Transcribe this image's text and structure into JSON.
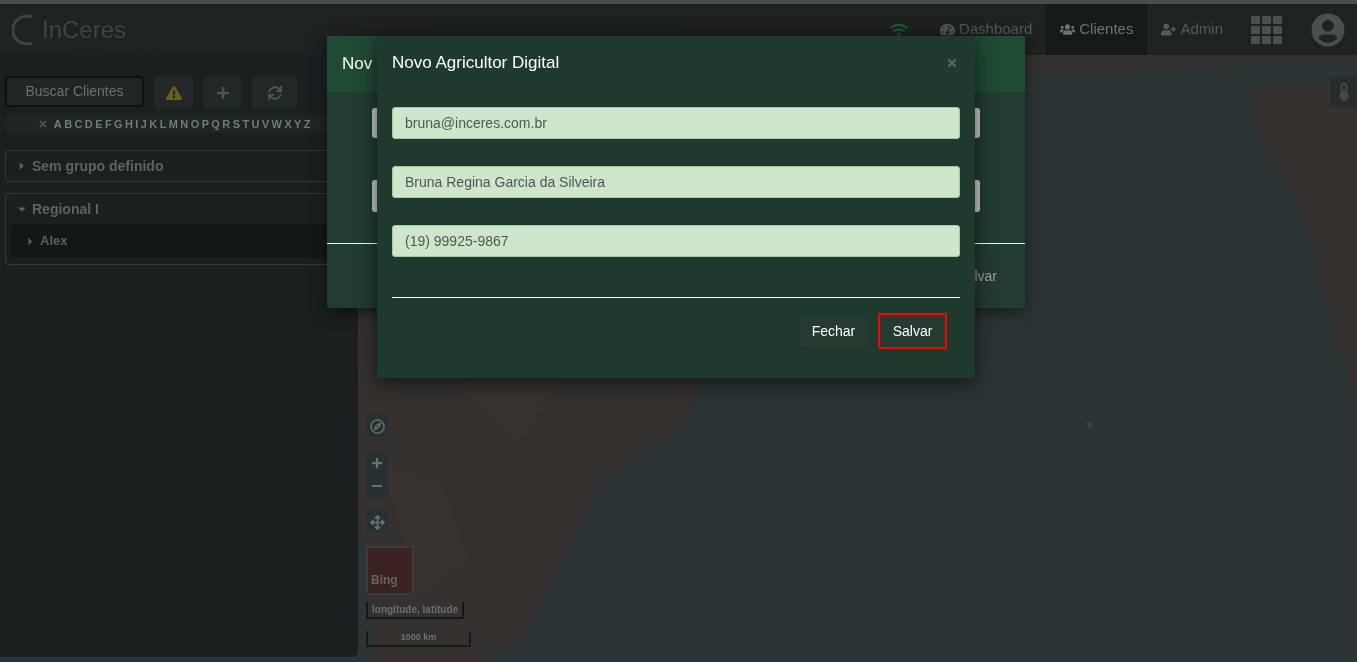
{
  "header": {
    "logo": "InCeres",
    "nav": [
      {
        "label": "Dashboard",
        "selected": false
      },
      {
        "label": "Clientes",
        "selected": true
      },
      {
        "label": "Admin",
        "selected": false
      }
    ]
  },
  "sidebar": {
    "search_button": "Buscar Clientes",
    "alphabet": [
      "A",
      "B",
      "C",
      "D",
      "E",
      "F",
      "G",
      "H",
      "I",
      "J",
      "K",
      "L",
      "M",
      "N",
      "O",
      "P",
      "Q",
      "R",
      "S",
      "T",
      "U",
      "V",
      "W",
      "X",
      "Y",
      "Z"
    ],
    "groups": [
      {
        "label": "Sem grupo definido",
        "expanded": false
      },
      {
        "label": "Regional I",
        "expanded": true,
        "children": [
          {
            "label": "Alex",
            "expanded": false
          }
        ]
      }
    ]
  },
  "map": {
    "attribution": "Bing",
    "coordinates": "longitude, latitude",
    "scale": "1000 km"
  },
  "background_dialog": {
    "title": "Nov",
    "button": "lvar"
  },
  "dialog": {
    "title": "Novo Agricultor Digital",
    "fields": [
      {
        "value": "bruna@inceres.com.br"
      },
      {
        "value": "Bruna Regina Garcia da Silveira"
      },
      {
        "value": "(19) 99925-9867"
      }
    ],
    "buttons": [
      {
        "label": "Fechar",
        "focused": false
      },
      {
        "label": "Salvar",
        "focused": true
      }
    ]
  }
}
